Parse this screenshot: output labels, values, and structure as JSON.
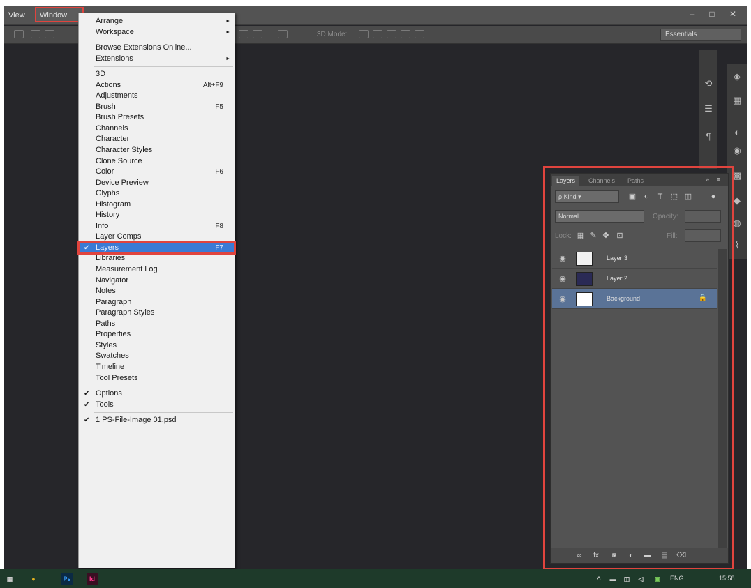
{
  "menubar": {
    "items": [
      "View",
      "Window"
    ],
    "window_controls": [
      "–",
      "□",
      "✕"
    ]
  },
  "optionsbar": {
    "hint_text": "3D Mode:",
    "workspace": "Essentials"
  },
  "window_menu": {
    "group1": [
      {
        "label": "Arrange",
        "submenu": true
      },
      {
        "label": "Workspace",
        "submenu": true
      }
    ],
    "group2": [
      {
        "label": "Browse Extensions Online..."
      },
      {
        "label": "Extensions",
        "submenu": true
      }
    ],
    "group3": [
      {
        "label": "3D"
      },
      {
        "label": "Actions",
        "shortcut": "Alt+F9"
      },
      {
        "label": "Adjustments"
      },
      {
        "label": "Brush",
        "shortcut": "F5"
      },
      {
        "label": "Brush Presets"
      },
      {
        "label": "Channels"
      },
      {
        "label": "Character"
      },
      {
        "label": "Character Styles"
      },
      {
        "label": "Clone Source"
      },
      {
        "label": "Color",
        "shortcut": "F6"
      },
      {
        "label": "Device Preview"
      },
      {
        "label": "Glyphs"
      },
      {
        "label": "Histogram"
      },
      {
        "label": "History"
      },
      {
        "label": "Info",
        "shortcut": "F8"
      },
      {
        "label": "Layer Comps"
      },
      {
        "label": "Layers",
        "shortcut": "F7",
        "checked": true,
        "selected": true
      },
      {
        "label": "Libraries"
      },
      {
        "label": "Measurement Log"
      },
      {
        "label": "Navigator"
      },
      {
        "label": "Notes"
      },
      {
        "label": "Paragraph"
      },
      {
        "label": "Paragraph Styles"
      },
      {
        "label": "Paths"
      },
      {
        "label": "Properties"
      },
      {
        "label": "Styles"
      },
      {
        "label": "Swatches"
      },
      {
        "label": "Timeline"
      },
      {
        "label": "Tool Presets"
      }
    ],
    "group4": [
      {
        "label": "Options",
        "checked": true
      },
      {
        "label": "Tools",
        "checked": true
      }
    ],
    "group5": [
      {
        "label": "1 PS-File-Image 01.psd",
        "checked": true
      }
    ]
  },
  "layers_panel": {
    "tabs": [
      "Layers",
      "Channels",
      "Paths"
    ],
    "filter_kind": "Kind",
    "blend_mode": "Normal",
    "opacity_label": "Opacity:",
    "lock_label": "Lock:",
    "fill_label": "Fill:",
    "layers": [
      {
        "name": "Layer 3",
        "thumb": "#f2f2f2",
        "selected": false
      },
      {
        "name": "Layer 2",
        "thumb": "#2a2a55",
        "selected": false
      },
      {
        "name": "Background",
        "thumb": "#ffffff",
        "selected": true,
        "locked": true
      }
    ]
  },
  "taskbar": {
    "lang": "ENG",
    "time": "15:58"
  }
}
